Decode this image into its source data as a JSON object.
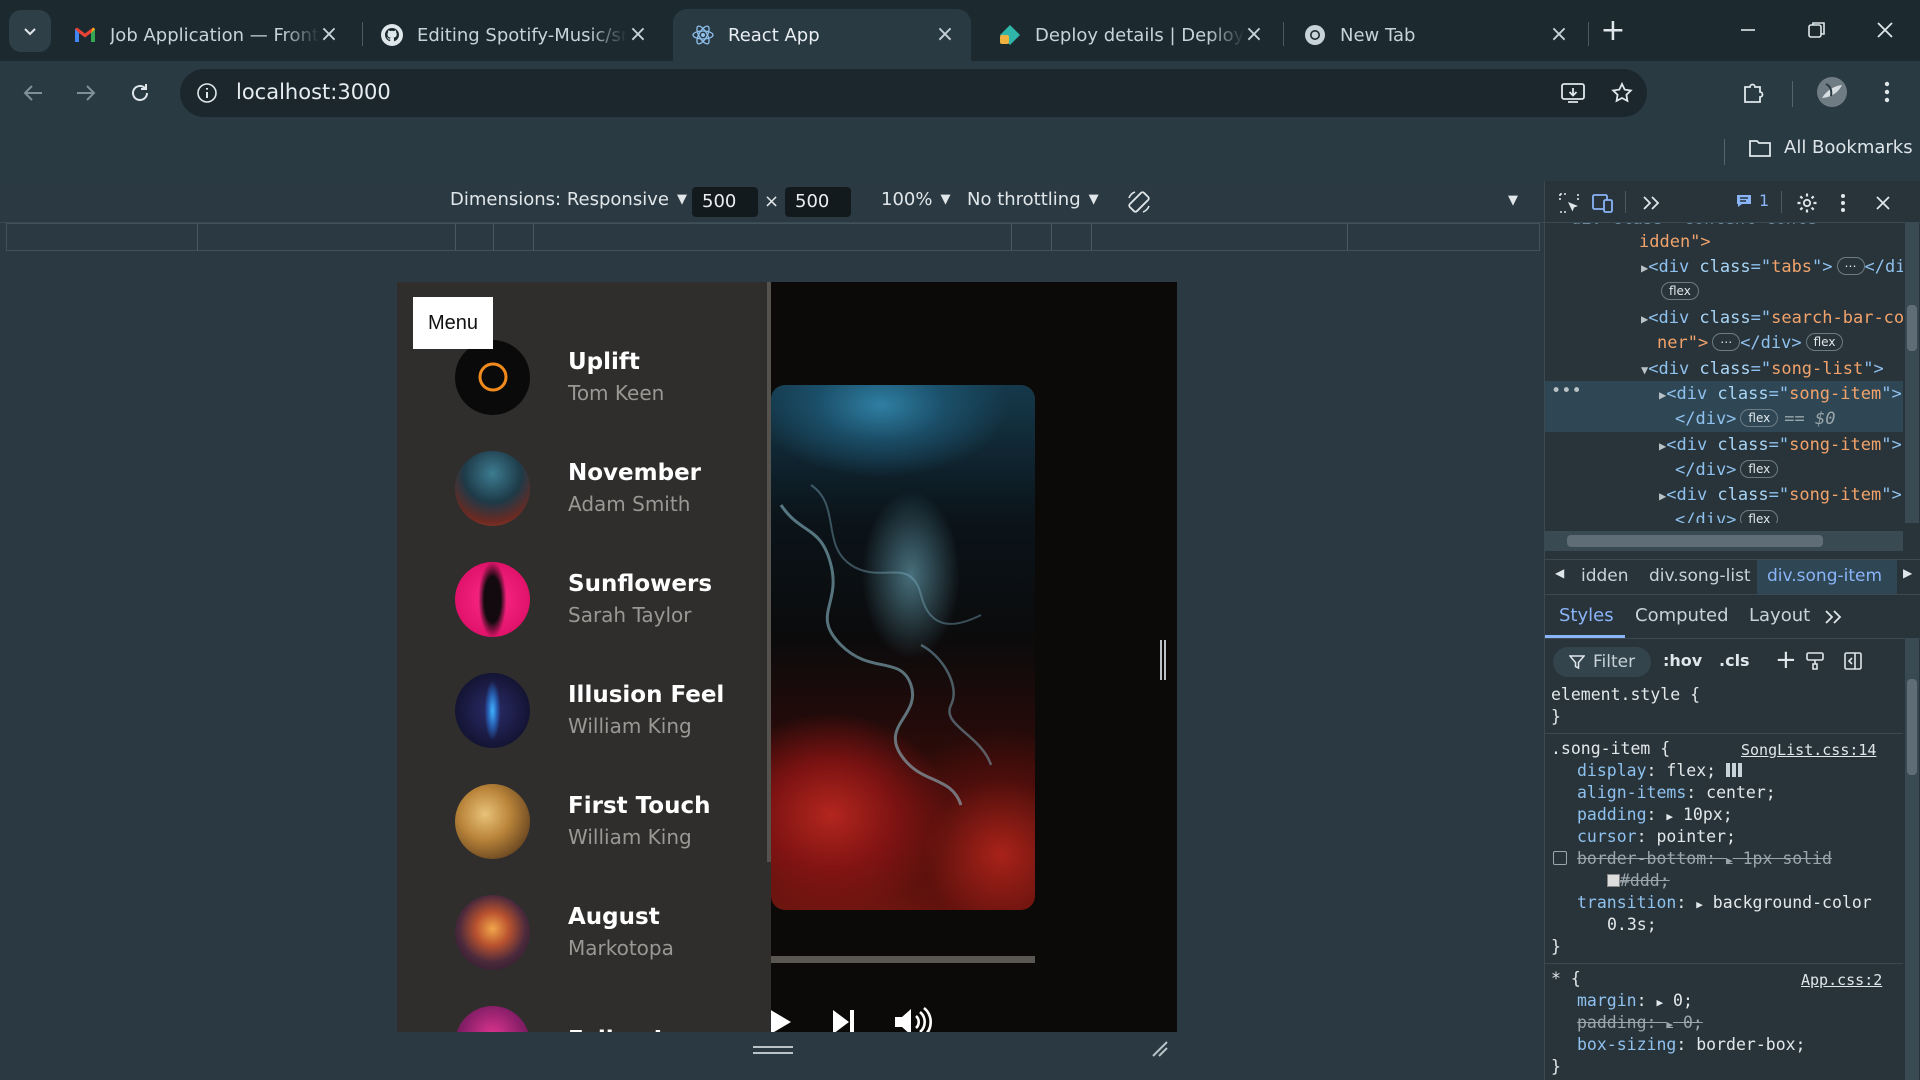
{
  "browser": {
    "tabs": [
      {
        "title": "Job Application — Frontend",
        "icon": "gmail-icon"
      },
      {
        "title": "Editing Spotify-Music/src",
        "icon": "github-icon"
      },
      {
        "title": "React App",
        "icon": "react-icon",
        "active": true
      },
      {
        "title": "Deploy details | Deploys | ",
        "icon": "netlify-icon"
      },
      {
        "title": "New Tab",
        "icon": "chrome-icon"
      }
    ],
    "url": "localhost:3000",
    "bookmarks_label": "All Bookmarks"
  },
  "device_toolbar": {
    "dimensions_label": "Dimensions: Responsive",
    "width": "500",
    "times": "×",
    "height": "500",
    "zoom": "100%",
    "throttling": "No throttling"
  },
  "app": {
    "menu_label": "Menu",
    "songs": [
      {
        "title": "Uplift",
        "artist": "Tom Keen"
      },
      {
        "title": "November",
        "artist": "Adam Smith"
      },
      {
        "title": "Sunflowers",
        "artist": "Sarah Taylor"
      },
      {
        "title": "Illusion Feel",
        "artist": "William King"
      },
      {
        "title": "First Touch",
        "artist": "William King"
      },
      {
        "title": "August",
        "artist": "Markotopa"
      },
      {
        "title": "Fallen Leaves",
        "artist": ""
      }
    ]
  },
  "devtools": {
    "issues_count": "1",
    "dom_lines": {
      "l0": "idden\">",
      "tabs_class": "tabs",
      "search_class": "search-bar-co",
      "search_cont": "ner\">",
      "songlist_class": "song-list",
      "songitem_class": "song-item",
      "flex": "flex",
      "eq0": "== $0"
    },
    "breadcrumbs": [
      "idden",
      "div.song-list",
      "div.song-item"
    ],
    "panel_tabs": [
      "Styles",
      "Computed",
      "Layout"
    ],
    "filter_label": "Filter",
    "hov": ":hov",
    "cls": ".cls",
    "styles": {
      "element_style": "element.style {",
      "close": "}",
      "song_item_selector": ".song-item {",
      "song_item_source": "SongList.css:14",
      "display_prop": "display",
      "display_val": "flex;",
      "align_prop": "align-items",
      "align_val": "center;",
      "padding_prop": "padding",
      "padding_val": "10px;",
      "cursor_prop": "cursor",
      "cursor_val": "pointer;",
      "border_prop": "border-bottom",
      "border_val": "1px solid",
      "border_color": "#ddd;",
      "transition_prop": "transition",
      "transition_val": "background-color",
      "transition_val2": "0.3s;",
      "star_selector": "* {",
      "star_source": "App.css:2",
      "margin_prop": "margin",
      "margin_val": "0;",
      "padding2_prop": "padding",
      "padding2_val": "0;",
      "boxsizing_prop": "box-sizing",
      "boxsizing_val": "border-box;"
    }
  },
  "colors": {
    "accent_blue": "#8ab4f8",
    "devtools_selected": "#2f4754"
  }
}
